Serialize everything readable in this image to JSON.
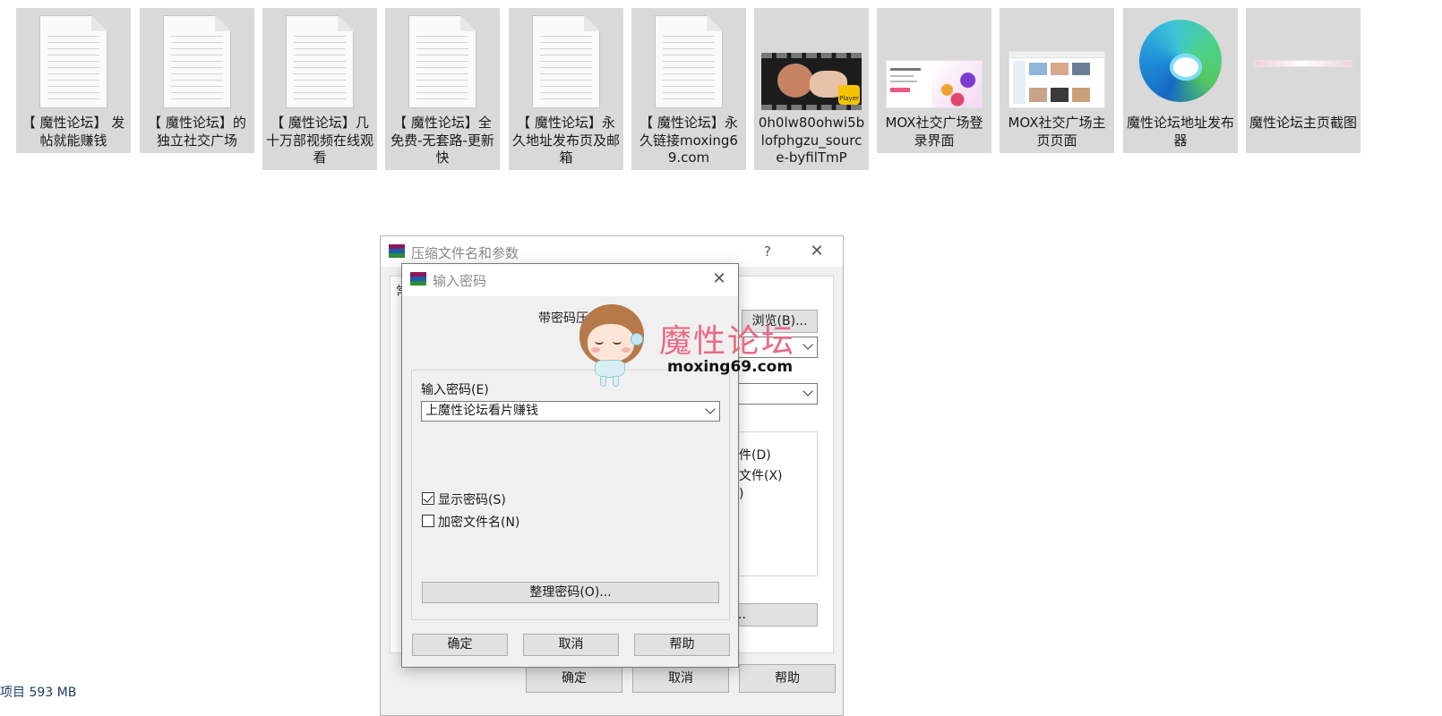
{
  "files": [
    {
      "label": "【 魔性论坛】 发帖就能赚钱",
      "icon": "document-icon"
    },
    {
      "label": "【 魔性论坛】的独立社交广场",
      "icon": "document-icon"
    },
    {
      "label": "【 魔性论坛】几十万部视频在线观看",
      "icon": "document-icon"
    },
    {
      "label": "【 魔性论坛】全免费-无套路-更新快",
      "icon": "document-icon"
    },
    {
      "label": "【 魔性论坛】永久地址发布页及邮箱",
      "icon": "document-icon"
    },
    {
      "label": "【 魔性论坛】永久链接moxing69.com",
      "icon": "document-icon"
    },
    {
      "label": "0h0lw80ohwi5blofphgzu_source-byfilTmP",
      "icon": "video-thumbnail",
      "badge": "Player"
    },
    {
      "label": "MOX社交广场登录界面",
      "icon": "image-thumbnail"
    },
    {
      "label": "MOX社交广场主页页面",
      "icon": "image-thumbnail"
    },
    {
      "label": "魔性论坛地址发布器",
      "icon": "edge-browser-icon"
    },
    {
      "label": "魔性论坛主页截图",
      "icon": "image-thumbnail"
    }
  ],
  "outer_dialog": {
    "title": "压缩文件名和参数",
    "help_glyph": "?",
    "close_glyph": "✕",
    "tab_fragment": "常",
    "browse_button": "浏览(B)...",
    "option_line1": "件(D)",
    "option_line2": "文件(X)",
    "option_line3": ")",
    "hidden_button_fragment": "..",
    "ok_button": "确定",
    "cancel_button": "取消",
    "help_button": "帮助"
  },
  "password_dialog": {
    "title": "输入密码",
    "close_glyph": "✕",
    "heading": "带密码压",
    "password_label": "输入密码(E)",
    "password_value": "上魔性论坛看片赚钱",
    "show_password_label": "显示密码(S)",
    "show_password_checked": true,
    "encrypt_filenames_label": "加密文件名(N)",
    "encrypt_filenames_checked": false,
    "organize_button": "整理密码(O)...",
    "ok_button": "确定",
    "cancel_button": "取消",
    "help_button": "帮助"
  },
  "watermark": {
    "title": "魔性论坛",
    "url": "moxing69.com"
  },
  "status_bar": {
    "text": "项目  593 MB"
  },
  "colors": {
    "tile_bg": "#d9d9d9",
    "dialog_bg": "#f0f0f0",
    "watermark_pink": "#e96a86"
  }
}
